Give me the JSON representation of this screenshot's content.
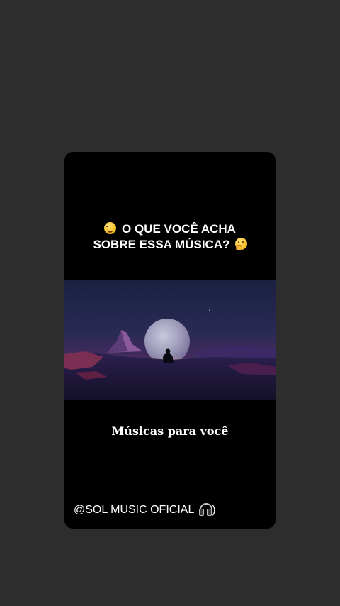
{
  "story": {
    "question_line1": "O QUE VOCÊ ACHA",
    "question_line2": "SOBRE ESSA MÚSICA?",
    "caption": "Músicas para você",
    "handle": "@SOL MUSIC OFICIAL",
    "handle_suffix": ")",
    "emoji_left": "smiling-face-icon",
    "emoji_right": "thinking-face-icon",
    "handle_icon": "headphones-icon"
  },
  "colors": {
    "page_background": "#2e2d2d",
    "card_background": "#000000",
    "text": "#ffffff"
  }
}
